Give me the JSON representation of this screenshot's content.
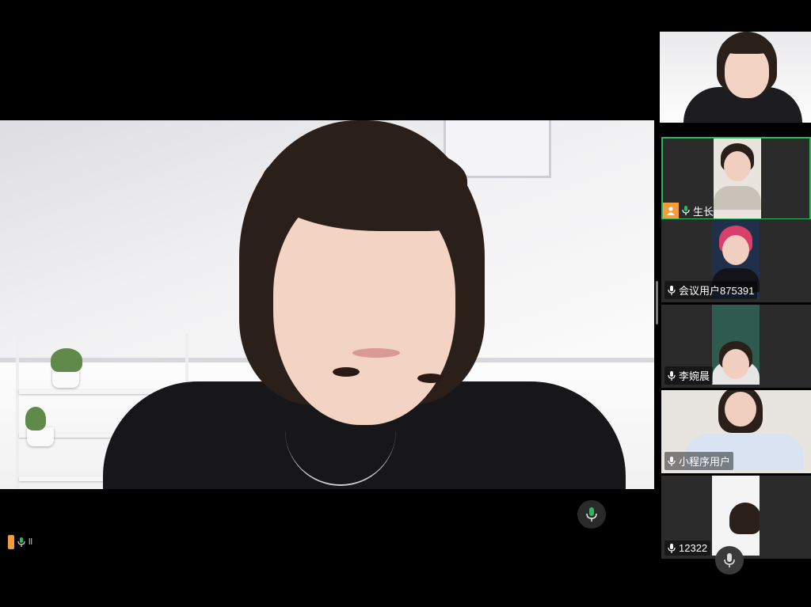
{
  "participants": [
    {
      "name": "生长",
      "host": true,
      "active": true
    },
    {
      "name": "会议用户875391",
      "host": false,
      "active": false
    },
    {
      "name": "李婉晨",
      "host": false,
      "active": false
    },
    {
      "name": "小程序用户",
      "host": false,
      "active": false
    },
    {
      "name": "12322",
      "host": false,
      "active": false
    }
  ],
  "self_indicator": {
    "label": "ll"
  },
  "colors": {
    "active_border": "#2fb75c",
    "host_badge": "#f39c3d",
    "mic_green": "#2fb75c"
  },
  "icons": {
    "mic": "microphone-icon",
    "host": "person-icon"
  }
}
